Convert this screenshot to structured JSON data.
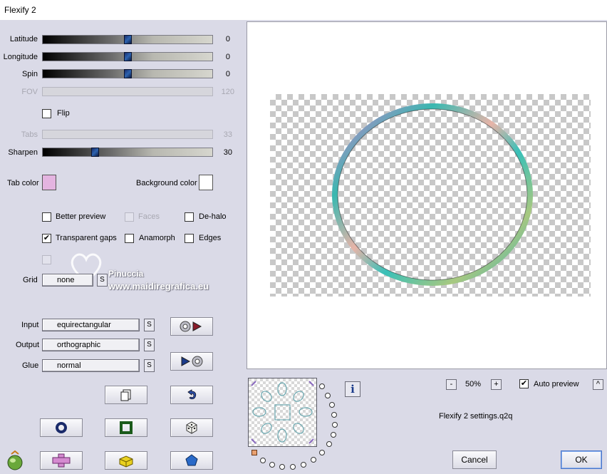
{
  "window": {
    "title": "Flexify 2"
  },
  "sliders": {
    "latitude": {
      "label": "Latitude",
      "value": "0",
      "fraction": 0.5
    },
    "longitude": {
      "label": "Longitude",
      "value": "0",
      "fraction": 0.5
    },
    "spin": {
      "label": "Spin",
      "value": "0",
      "fraction": 0.5
    },
    "fov": {
      "label": "FOV",
      "value": "120",
      "fraction": 0.0
    },
    "tabs": {
      "label": "Tabs",
      "value": "33",
      "fraction": 0.0
    },
    "sharpen": {
      "label": "Sharpen",
      "value": "30",
      "fraction": 0.3
    }
  },
  "options": {
    "flip": {
      "label": "Flip",
      "checked": false
    },
    "better_preview": {
      "label": "Better preview",
      "checked": false
    },
    "faces": {
      "label": "Faces",
      "checked": false
    },
    "de_halo": {
      "label": "De-halo",
      "checked": false
    },
    "transparent_gaps": {
      "label": "Transparent gaps",
      "checked": true,
      "mark": "✔"
    },
    "anamorph": {
      "label": "Anamorph",
      "checked": false
    },
    "edges": {
      "label": "Edges",
      "checked": false
    }
  },
  "colors": {
    "tab_color_label": "Tab color",
    "tab_color": "#e4b4e0",
    "background_color_label": "Background color",
    "background_color": "#ffffff"
  },
  "grid": {
    "label": "Grid",
    "value": "none",
    "s_label": "S"
  },
  "projection": {
    "input_label": "Input",
    "input_value": "equirectangular",
    "output_label": "Output",
    "output_value": "orthographic",
    "glue_label": "Glue",
    "glue_value": "normal",
    "s_label": "S"
  },
  "watermark": {
    "line1": "Pinuccia",
    "line2": "www.maidiregrafica.eu"
  },
  "zoom": {
    "minus": "-",
    "value": "50%",
    "plus": "+"
  },
  "auto_preview": {
    "label": "Auto preview",
    "checked": true,
    "mark": "✔",
    "arrow": "^"
  },
  "settings_file": "Flexify 2 settings.q2q",
  "buttons": {
    "cancel": "Cancel",
    "ok": "OK",
    "info": "i"
  },
  "icons": [
    "copy-icon",
    "undo-icon",
    "ring-icon",
    "square-icon",
    "dice-icon",
    "cross-icon",
    "brick-icon",
    "pentagon-icon",
    "globe-play-icon",
    "play-globe-icon",
    "logo-icon",
    "info-icon"
  ]
}
